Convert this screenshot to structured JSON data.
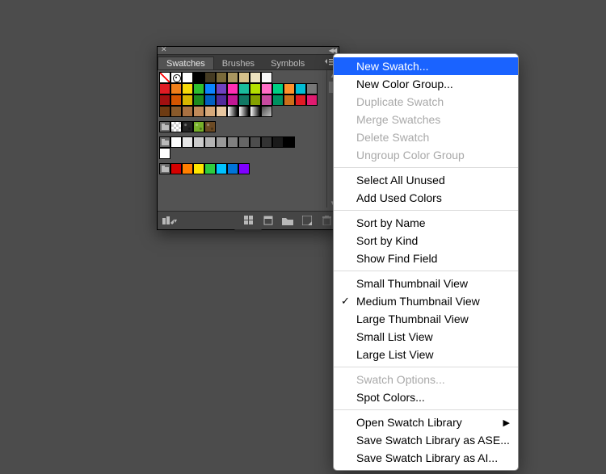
{
  "panel": {
    "tabs": [
      "Swatches",
      "Brushes",
      "Symbols"
    ],
    "active_tab_index": 0,
    "swatch_rows": [
      [
        {
          "t": "none"
        },
        {
          "t": "reg"
        },
        {
          "c": "#ffffff"
        },
        {
          "c": "#000000"
        },
        {
          "c": "#453b23"
        },
        {
          "c": "#7a6a3a"
        },
        {
          "c": "#aa9760"
        },
        {
          "c": "#d6c18a"
        },
        {
          "c": "#ede3bf"
        },
        {
          "c": "#f8f8f8"
        },
        {
          "t": "empty"
        },
        {
          "t": "empty"
        },
        {
          "t": "empty"
        },
        {
          "t": "empty"
        }
      ],
      [
        {
          "c": "#e01b24"
        },
        {
          "c": "#ef7f1a"
        },
        {
          "c": "#f5d90a"
        },
        {
          "c": "#2fbf2f"
        },
        {
          "c": "#0a84ff"
        },
        {
          "c": "#6f42c1"
        },
        {
          "c": "#ff2fb3"
        },
        {
          "c": "#1abc9c"
        },
        {
          "c": "#b4e000"
        },
        {
          "c": "#ff6ec7"
        },
        {
          "c": "#00d084"
        },
        {
          "c": "#ff922b"
        },
        {
          "c": "#00bcd4"
        },
        {
          "c": "#777777"
        }
      ],
      [
        {
          "c": "#a11010"
        },
        {
          "c": "#d45500"
        },
        {
          "c": "#d7b600"
        },
        {
          "c": "#1e8a1e"
        },
        {
          "c": "#0060c0"
        },
        {
          "c": "#512c9b"
        },
        {
          "c": "#c21894"
        },
        {
          "c": "#117864"
        },
        {
          "c": "#84a000"
        },
        {
          "c": "#c74aa0"
        },
        {
          "c": "#009060"
        },
        {
          "c": "#cb6f1b"
        },
        {
          "c": "#e01b24"
        },
        {
          "c": "#e01b70"
        }
      ],
      [
        {
          "c": "#6e3b12"
        },
        {
          "c": "#8a5a2b"
        },
        {
          "c": "#a97142"
        },
        {
          "c": "#c08a5a"
        },
        {
          "c": "#d6a97a"
        },
        {
          "c": "#e8c7a0"
        },
        {
          "t": "grad"
        },
        {
          "t": "grad"
        },
        {
          "t": "grad"
        },
        {
          "c": "#4b4b4b",
          "grad": "#c0c0c0"
        },
        {
          "t": "empty"
        },
        {
          "t": "empty"
        },
        {
          "t": "empty"
        },
        {
          "t": "empty"
        }
      ],
      [
        {
          "t": "folder"
        },
        {
          "t": "check"
        },
        {
          "c": "#222",
          "pat": 1
        },
        {
          "c": "#77b02a",
          "pat": 1
        },
        {
          "c": "#6b4a24",
          "pat": 1
        },
        {
          "t": "empty"
        },
        {
          "t": "empty"
        },
        {
          "t": "empty"
        },
        {
          "t": "empty"
        },
        {
          "t": "empty"
        },
        {
          "t": "empty"
        },
        {
          "t": "empty"
        },
        {
          "t": "empty"
        },
        {
          "t": "empty"
        }
      ],
      [
        {
          "t": "folder"
        },
        {
          "c": "#ffffff"
        },
        {
          "c": "#e6e6e6"
        },
        {
          "c": "#cccccc"
        },
        {
          "c": "#b3b3b3"
        },
        {
          "c": "#999999"
        },
        {
          "c": "#808080"
        },
        {
          "c": "#666666"
        },
        {
          "c": "#4d4d4d"
        },
        {
          "c": "#333333"
        },
        {
          "c": "#1a1a1a"
        },
        {
          "c": "#000000"
        },
        {
          "t": "empty"
        },
        {
          "t": "empty"
        }
      ],
      [
        {
          "c": "#ffffff"
        },
        {
          "t": "empty"
        },
        {
          "t": "empty"
        },
        {
          "t": "empty"
        },
        {
          "t": "empty"
        },
        {
          "t": "empty"
        },
        {
          "t": "empty"
        },
        {
          "t": "empty"
        },
        {
          "t": "empty"
        },
        {
          "t": "empty"
        },
        {
          "t": "empty"
        },
        {
          "t": "empty"
        },
        {
          "t": "empty"
        },
        {
          "t": "empty"
        }
      ],
      [
        {
          "t": "folder"
        },
        {
          "c": "#d40000"
        },
        {
          "c": "#ff7f00"
        },
        {
          "c": "#ffe600"
        },
        {
          "c": "#2ecc40"
        },
        {
          "c": "#00c2ff"
        },
        {
          "c": "#0074d9"
        },
        {
          "c": "#7f00ff"
        },
        {
          "t": "empty"
        },
        {
          "t": "empty"
        },
        {
          "t": "empty"
        },
        {
          "t": "empty"
        },
        {
          "t": "empty"
        },
        {
          "t": "empty"
        }
      ]
    ],
    "footer_icons": {
      "library_menu": "library-menu-icon",
      "show_kinds": "show-swatch-kinds-icon",
      "swatch_options": "swatch-options-icon",
      "new_group": "new-color-group-icon",
      "new_swatch": "new-swatch-icon",
      "delete": "delete-swatch-icon"
    }
  },
  "menu": {
    "groups": [
      [
        {
          "label": "New Swatch...",
          "state": "highlight"
        },
        {
          "label": "New Color Group..."
        },
        {
          "label": "Duplicate Swatch",
          "state": "disabled"
        },
        {
          "label": "Merge Swatches",
          "state": "disabled"
        },
        {
          "label": "Delete Swatch",
          "state": "disabled"
        },
        {
          "label": "Ungroup Color Group",
          "state": "disabled"
        }
      ],
      [
        {
          "label": "Select All Unused"
        },
        {
          "label": "Add Used Colors"
        }
      ],
      [
        {
          "label": "Sort by Name"
        },
        {
          "label": "Sort by Kind"
        },
        {
          "label": "Show Find Field"
        }
      ],
      [
        {
          "label": "Small Thumbnail View"
        },
        {
          "label": "Medium Thumbnail View",
          "checked": true
        },
        {
          "label": "Large Thumbnail View"
        },
        {
          "label": "Small List View"
        },
        {
          "label": "Large List View"
        }
      ],
      [
        {
          "label": "Swatch Options...",
          "state": "disabled"
        },
        {
          "label": "Spot Colors..."
        }
      ],
      [
        {
          "label": "Open Swatch Library",
          "submenu": true
        },
        {
          "label": "Save Swatch Library as ASE..."
        },
        {
          "label": "Save Swatch Library as AI..."
        }
      ]
    ]
  }
}
